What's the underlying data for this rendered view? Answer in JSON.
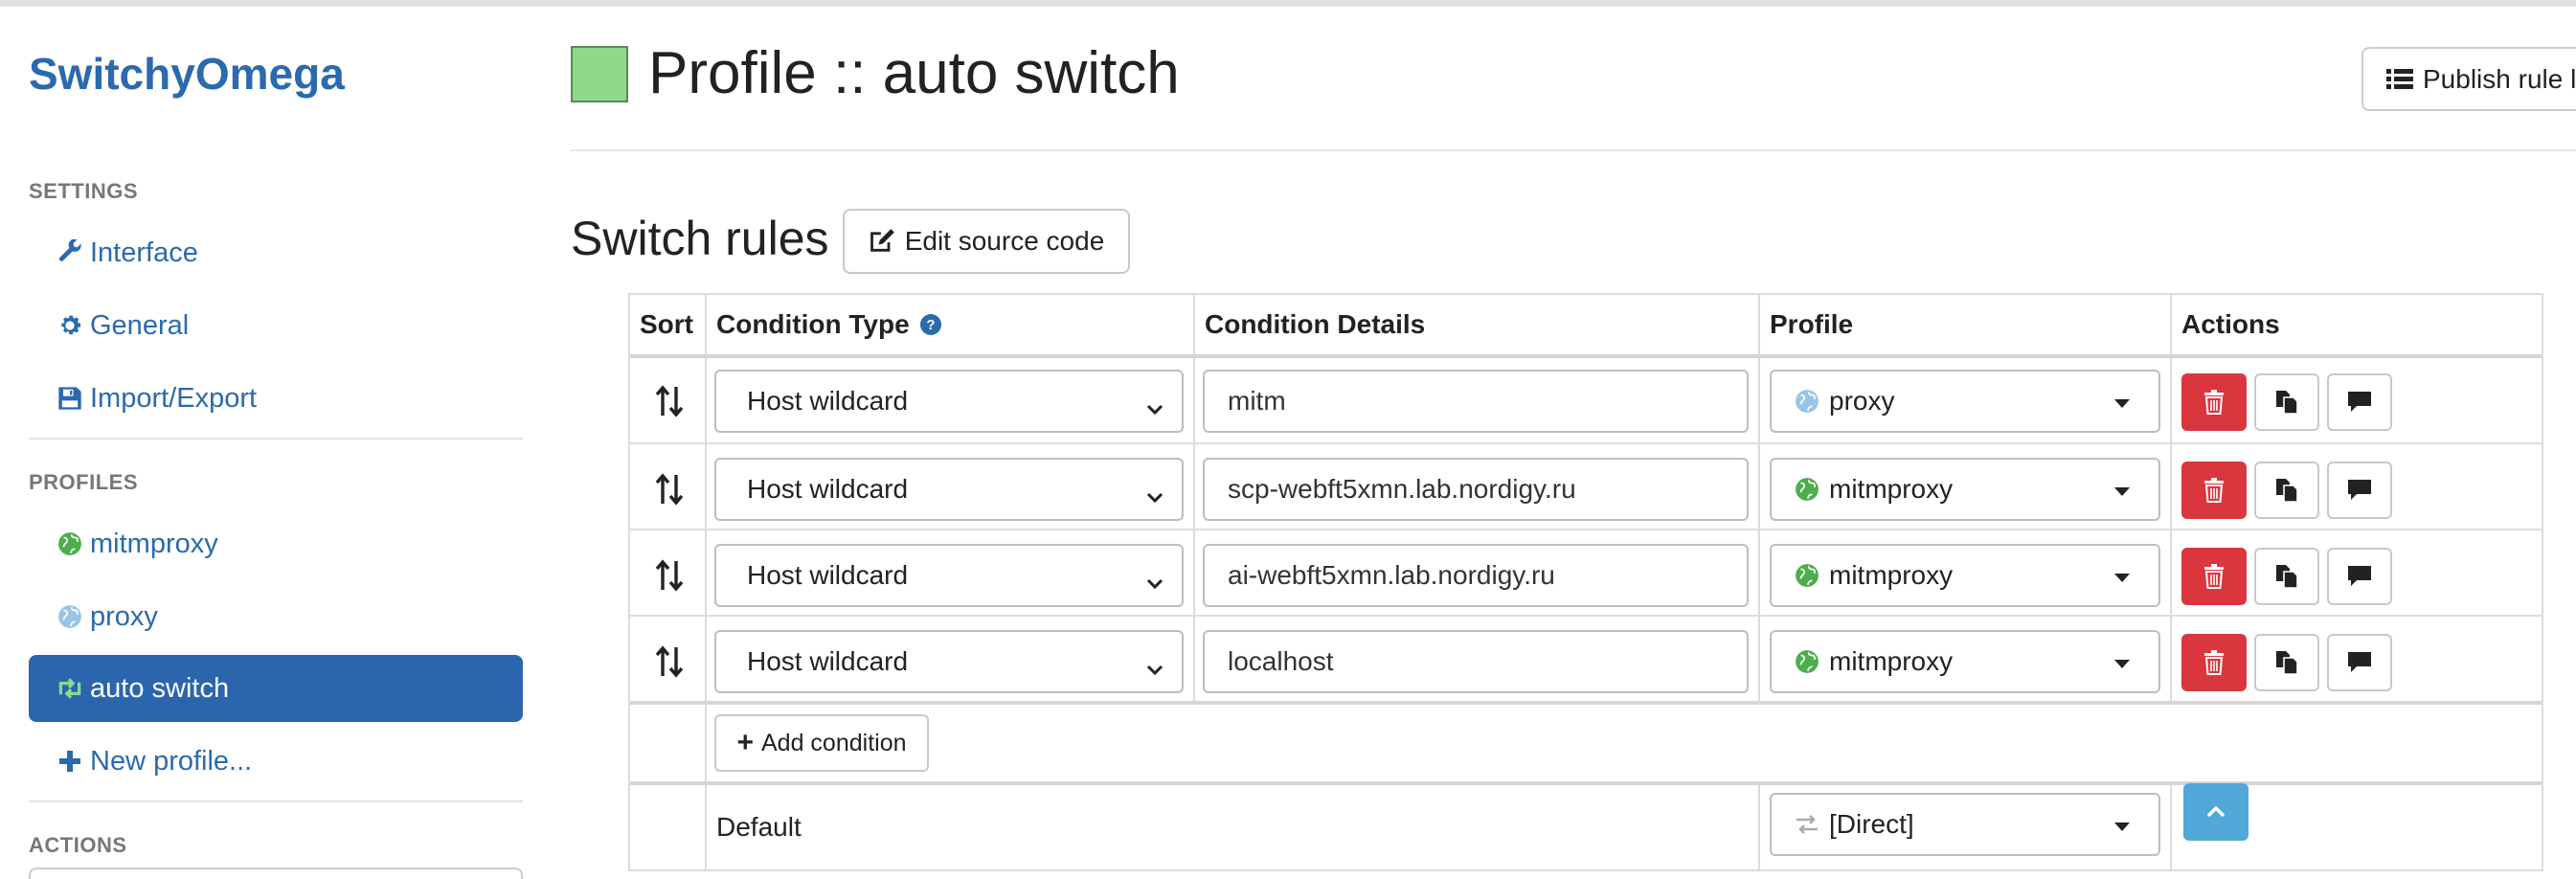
{
  "app": {
    "brand": "SwitchyOmega"
  },
  "sidebar": {
    "settings_heading": "SETTINGS",
    "settings_items": [
      {
        "label": "Interface",
        "icon": "wrench-icon"
      },
      {
        "label": "General",
        "icon": "gear-icon"
      },
      {
        "label": "Import/Export",
        "icon": "floppy-disk-icon"
      }
    ],
    "profiles_heading": "PROFILES",
    "profile_items": [
      {
        "label": "mitmproxy",
        "icon": "globe-icon",
        "color": "#4cae4c"
      },
      {
        "label": "proxy",
        "icon": "globe-icon",
        "color": "#99c4e8"
      },
      {
        "label": "auto switch",
        "icon": "retweet-icon",
        "active": true
      },
      {
        "label": "New profile...",
        "icon": "plus-icon"
      }
    ],
    "actions_heading": "ACTIONS"
  },
  "header": {
    "title": "Profile :: auto switch",
    "swatch_color": "#8ed98a",
    "publish_label": "Publish rule li"
  },
  "switch_rules": {
    "title": "Switch rules",
    "edit_source_label": "Edit source code",
    "columns": {
      "sort": "Sort",
      "condition_type": "Condition Type",
      "condition_details": "Condition Details",
      "profile": "Profile",
      "actions": "Actions"
    },
    "rules": [
      {
        "condition_type": "Host wildcard",
        "condition_details": "mitm",
        "profile": "proxy",
        "profile_color": "#99c4e8"
      },
      {
        "condition_type": "Host wildcard",
        "condition_details": "scp-webft5xmn.lab.nordigy.ru",
        "profile": "mitmproxy",
        "profile_color": "#4cae4c"
      },
      {
        "condition_type": "Host wildcard",
        "condition_details": "ai-webft5xmn.lab.nordigy.ru",
        "profile": "mitmproxy",
        "profile_color": "#4cae4c"
      },
      {
        "condition_type": "Host wildcard",
        "condition_details": "localhost",
        "profile": "mitmproxy",
        "profile_color": "#4cae4c"
      }
    ],
    "add_condition_label": "Add condition",
    "default_label": "Default",
    "default_profile": "[Direct]"
  },
  "colors": {
    "accent": "#2a6aad",
    "danger": "#d9363e",
    "info": "#4fa8d8"
  }
}
